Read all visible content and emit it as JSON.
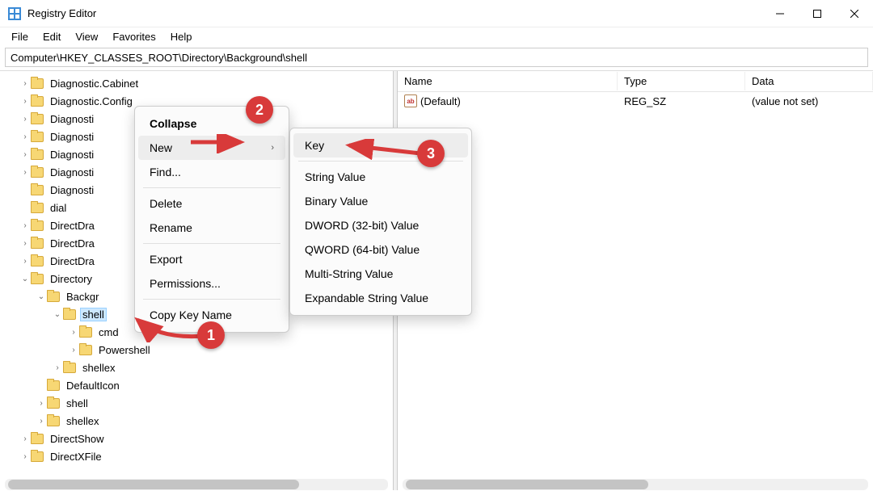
{
  "window": {
    "title": "Registry Editor"
  },
  "menubar": [
    "File",
    "Edit",
    "View",
    "Favorites",
    "Help"
  ],
  "address": "Computer\\HKEY_CLASSES_ROOT\\Directory\\Background\\shell",
  "tree": [
    {
      "indent": 1,
      "exp": "closed",
      "label": "Diagnostic.Cabinet"
    },
    {
      "indent": 1,
      "exp": "closed",
      "label": "Diagnostic.Config"
    },
    {
      "indent": 1,
      "exp": "closed",
      "label": "Diagnosti"
    },
    {
      "indent": 1,
      "exp": "closed",
      "label": "Diagnosti"
    },
    {
      "indent": 1,
      "exp": "closed",
      "label": "Diagnosti"
    },
    {
      "indent": 1,
      "exp": "closed",
      "label": "Diagnosti"
    },
    {
      "indent": 1,
      "exp": "none",
      "label": "Diagnosti"
    },
    {
      "indent": 1,
      "exp": "none",
      "label": "dial"
    },
    {
      "indent": 1,
      "exp": "closed",
      "label": "DirectDra"
    },
    {
      "indent": 1,
      "exp": "closed",
      "label": "DirectDra"
    },
    {
      "indent": 1,
      "exp": "closed",
      "label": "DirectDra"
    },
    {
      "indent": 1,
      "exp": "open",
      "label": "Directory"
    },
    {
      "indent": 2,
      "exp": "open",
      "label": "Backgr"
    },
    {
      "indent": 3,
      "exp": "open",
      "label": "shell",
      "selected": true
    },
    {
      "indent": 4,
      "exp": "closed",
      "label": "cmd"
    },
    {
      "indent": 4,
      "exp": "closed",
      "label": "Powershell"
    },
    {
      "indent": 3,
      "exp": "closed",
      "label": "shellex"
    },
    {
      "indent": 2,
      "exp": "none",
      "label": "DefaultIcon"
    },
    {
      "indent": 2,
      "exp": "closed",
      "label": "shell"
    },
    {
      "indent": 2,
      "exp": "closed",
      "label": "shellex"
    },
    {
      "indent": 1,
      "exp": "closed",
      "label": "DirectShow"
    },
    {
      "indent": 1,
      "exp": "closed",
      "label": "DirectXFile"
    }
  ],
  "list": {
    "columns": {
      "name": "Name",
      "type": "Type",
      "data": "Data"
    },
    "rows": [
      {
        "name": "(Default)",
        "type": "REG_SZ",
        "data": "(value not set)"
      }
    ]
  },
  "context1": {
    "items": [
      {
        "label": "Collapse",
        "bold": true
      },
      {
        "label": "New",
        "submenu": true,
        "hover": true
      },
      {
        "label": "Find...",
        "trailingSep": true
      },
      {
        "label": "Delete"
      },
      {
        "label": "Rename",
        "trailingSep": true
      },
      {
        "label": "Export"
      },
      {
        "label": "Permissions...",
        "trailingSep": true
      },
      {
        "label": "Copy Key Name"
      }
    ]
  },
  "context2": {
    "items": [
      {
        "label": "Key",
        "hover": true,
        "trailingSep": true
      },
      {
        "label": "String Value"
      },
      {
        "label": "Binary Value"
      },
      {
        "label": "DWORD (32-bit) Value"
      },
      {
        "label": "QWORD (64-bit) Value"
      },
      {
        "label": "Multi-String Value"
      },
      {
        "label": "Expandable String Value"
      }
    ]
  },
  "annotations": {
    "one": "1",
    "two": "2",
    "three": "3"
  }
}
